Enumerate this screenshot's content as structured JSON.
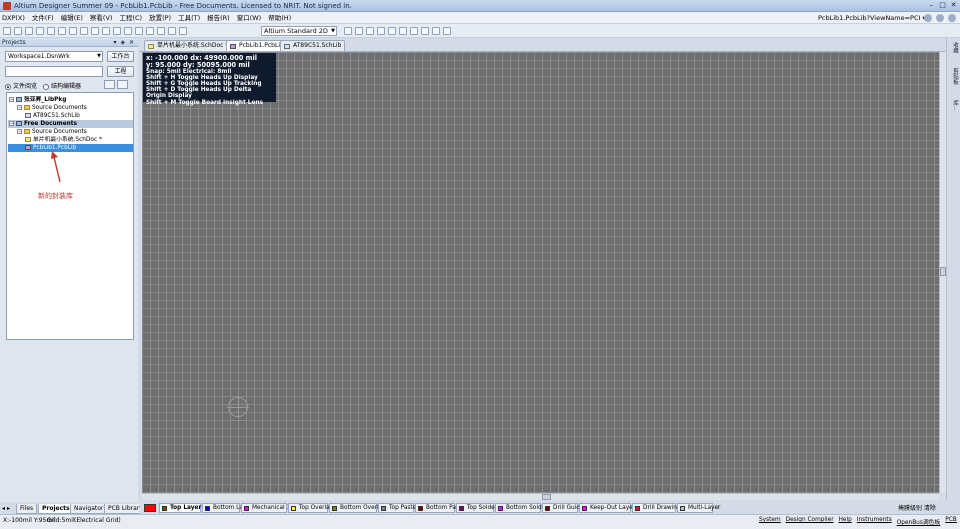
{
  "window": {
    "title": "Altium Designer Summer 09 - PcbLib1.PcbLib - Free Documents. Licensed to NRIT. Not signed in."
  },
  "menu": {
    "items": [
      "DXP(X)",
      "文件(F)",
      "编辑(E)",
      "察看(V)",
      "工程(C)",
      "放置(P)",
      "工具(T)",
      "报告(R)",
      "窗口(W)",
      "帮助(H)"
    ],
    "view_path": "PcbLib1.PcbLib?ViewName=PCI ▾"
  },
  "toolbar": {
    "view_mode": "Altium Standard 2D"
  },
  "projects_panel": {
    "title": "Projects",
    "workspace_value": "Workspace1.DsnWrk",
    "workspace_button": "工作台",
    "project_button": "工程",
    "radio_file_view": "文件阅览",
    "radio_struct_editor": "结构编辑器",
    "tree": [
      {
        "label": "张亚昇_LibPkg",
        "level": 0,
        "kind": "pkg",
        "bold": true
      },
      {
        "label": "Source Documents",
        "level": 1,
        "kind": "folder"
      },
      {
        "label": "AT89C51.SchLib",
        "level": 2,
        "kind": "lib"
      },
      {
        "label": "Free Documents",
        "level": 0,
        "kind": "pkg",
        "bold": true
      },
      {
        "label": "Source Documents",
        "level": 1,
        "kind": "folder"
      },
      {
        "label": "单片机最小系统.SchDoc *",
        "level": 2,
        "kind": "sch"
      },
      {
        "label": "PcbLib1.PcbLib",
        "level": 2,
        "kind": "pcb"
      }
    ],
    "annotation": "新的封装库"
  },
  "left_tabs": [
    "Files",
    "Projects",
    "Navigator",
    "PCB Library"
  ],
  "document_tabs": [
    {
      "label": "单片机最小系统.SchDoc *",
      "active": false
    },
    {
      "label": "PcbLib1.PcbLib",
      "active": true
    },
    {
      "label": "AT89C51.SchLib",
      "active": false
    }
  ],
  "hud": {
    "line1": "x: -100.000   dx: 49900.000 mil",
    "line2": "y:   95.000   dy: 50095.000 mil",
    "snap": "Snap: 5mil Electrical: 8mil",
    "shortcuts": [
      "Shift + H   Toggle Heads Up Display",
      "Shift + G   Toggle Heads Up Tracking",
      "Shift + D   Toggle Heads Up Delta Origin Display",
      "Shift + M   Toggle Board Insight Lens"
    ]
  },
  "layers": [
    {
      "label": "Top Layer",
      "color": "#ff0000",
      "active": true
    },
    {
      "label": "Bottom Layer",
      "color": "#0000ff"
    },
    {
      "label": "Mechanical 1",
      "color": "#ff00ff"
    },
    {
      "label": "Top Overlay",
      "color": "#ffff00"
    },
    {
      "label": "Bottom Overlay",
      "color": "#808000"
    },
    {
      "label": "Top Paste",
      "color": "#808080"
    },
    {
      "label": "Bottom Paste",
      "color": "#800000"
    },
    {
      "label": "Top Solder",
      "color": "#800080"
    },
    {
      "label": "Bottom Solder",
      "color": "#ff00ff"
    },
    {
      "label": "Drill Guide",
      "color": "#800000"
    },
    {
      "label": "Keep-Out Layer",
      "color": "#ff00ff"
    },
    {
      "label": "Drill Drawing",
      "color": "#ff002a"
    },
    {
      "label": "Multi-Layer",
      "color": "#c0c0c0"
    }
  ],
  "layerbar_right": "掩膜级别   清除",
  "right_strip": [
    "收藏",
    "剪贴板",
    "库..."
  ],
  "status": {
    "coords": "X:-100mil Y:95mil",
    "grid": "Grid:5mil",
    "electrical": "(Electrical Grid)",
    "panels": [
      "System",
      "Design Compiler",
      "Help",
      "Instruments",
      "OpenBus调色板",
      "PCB",
      ">>"
    ]
  }
}
